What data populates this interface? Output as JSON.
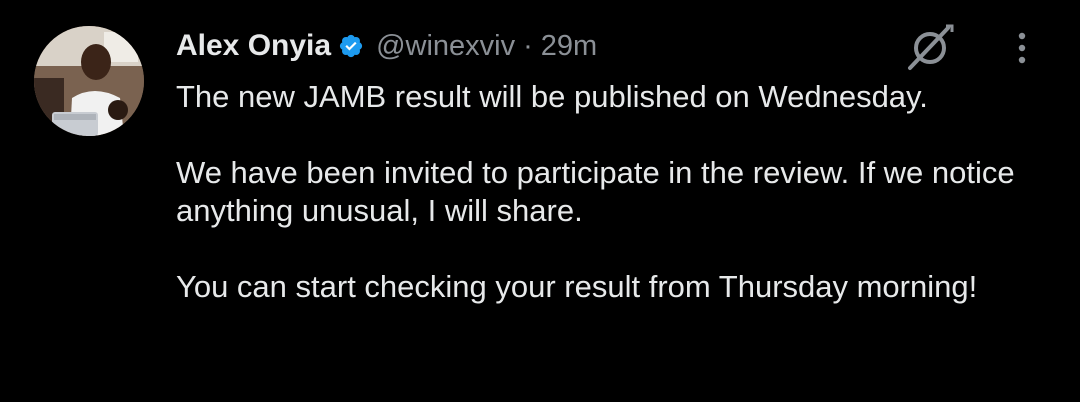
{
  "tweet": {
    "author": {
      "display_name": "Alex Onyia",
      "handle": "@winexviv",
      "verified": true,
      "avatar_icon": "avatar-photo"
    },
    "separator": "·",
    "timestamp": "29m",
    "lines": [
      "The new JAMB result will be published on Wednesday.",
      "We have been invited to participate in the review. If we notice anything unusual, I will share.",
      "You can start checking your result from Thursday morning!"
    ],
    "actions": {
      "grok_icon": "grok-icon",
      "more_icon": "more-options-icon"
    }
  },
  "colors": {
    "background": "#000000",
    "text": "#e7e9ea",
    "secondary": "#8b9096",
    "verified": "#1d9bf0"
  }
}
